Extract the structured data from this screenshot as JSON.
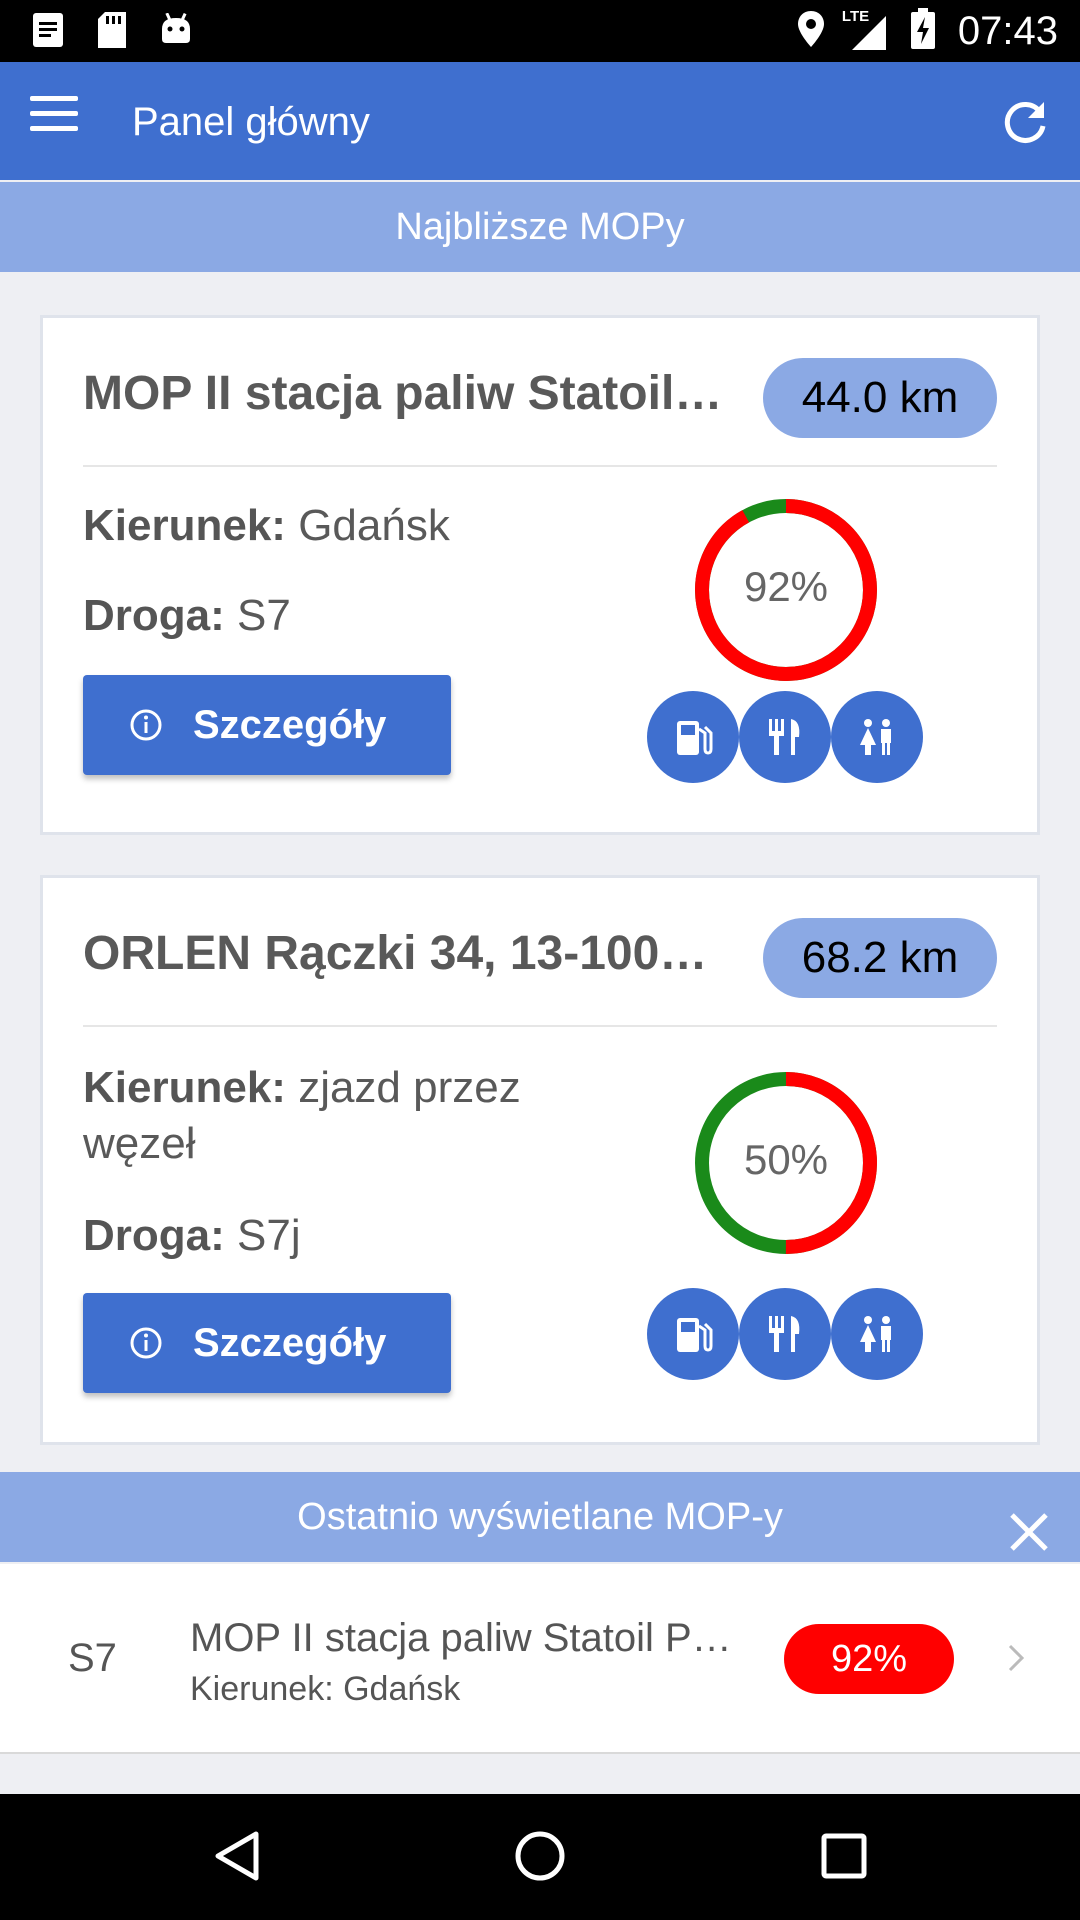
{
  "status_bar": {
    "time": "07:43",
    "left_icons": [
      "notes-icon",
      "sd-card-icon",
      "android-icon"
    ],
    "right_icons": [
      "location-icon",
      "lte-signal-icon",
      "battery-charging-icon"
    ],
    "network_label": "LTE"
  },
  "app_bar": {
    "title": "Panel główny",
    "menu_icon": "menu-icon",
    "refresh_icon": "refresh-icon"
  },
  "nearest": {
    "header": "Najbliższe MOPy",
    "cards": [
      {
        "title": "MOP II stacja paliw Statoil…",
        "distance": "44.0 km",
        "direction_label": "Kierunek:",
        "direction_value": "Gdańsk",
        "road_label": "Droga:",
        "road_value": "S7",
        "details_label": "Szczegóły",
        "occupancy_label": "92%",
        "occupancy": 0.92,
        "amenities": [
          "fuel-icon",
          "restaurant-icon",
          "toilet-icon"
        ]
      },
      {
        "title": "ORLEN Rączki 34, 13-100…",
        "distance": "68.2 km",
        "direction_label": "Kierunek:",
        "direction_value": "zjazd przez węzeł",
        "road_label": "Droga:",
        "road_value": "S7j",
        "details_label": "Szczegóły",
        "occupancy_label": "50%",
        "occupancy": 0.5,
        "amenities": [
          "fuel-icon",
          "restaurant-icon",
          "toilet-icon"
        ]
      }
    ]
  },
  "recent": {
    "header": "Ostatnio wyświetlane MOP-y",
    "items": [
      {
        "road": "S7",
        "name": "MOP II stacja paliw Statoil P…",
        "direction": "Kierunek: Gdańsk",
        "badge": "92%"
      }
    ]
  },
  "colors": {
    "primary": "#3f6fcf",
    "header_light": "#8ba9e4",
    "occupied": "#ff0000",
    "free": "#1a8a1a"
  }
}
